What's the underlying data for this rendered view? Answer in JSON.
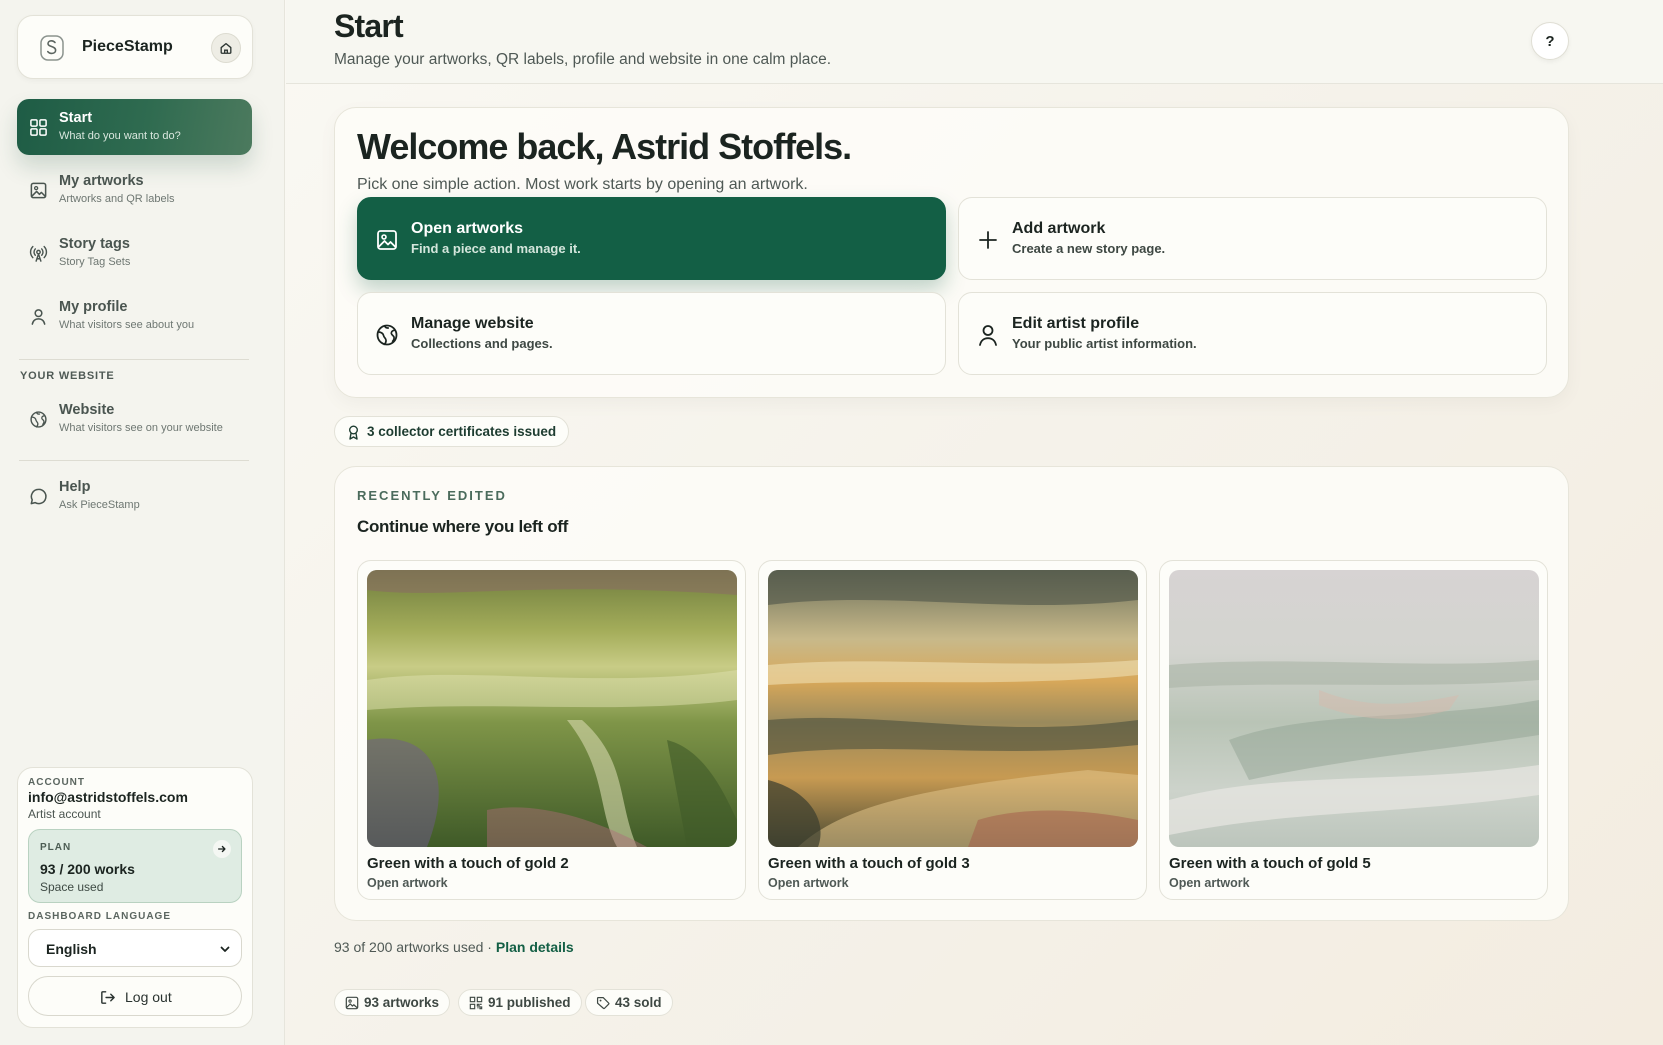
{
  "app": {
    "name": "PieceStamp"
  },
  "header": {
    "title": "Start",
    "subtitle": "Manage your artworks, QR labels, profile and website in one calm place.",
    "help_label": "?"
  },
  "sidebar": {
    "items": [
      {
        "title": "Start",
        "subtitle": "What do you want to do?",
        "icon": "grid-icon",
        "active": true
      },
      {
        "title": "My artworks",
        "subtitle": "Artworks and QR labels",
        "icon": "image-icon"
      },
      {
        "title": "Story tags",
        "subtitle": "Story Tag Sets",
        "icon": "broadcast-icon"
      },
      {
        "title": "My profile",
        "subtitle": "What visitors see about you",
        "icon": "user-icon"
      }
    ],
    "section_label": "YOUR WEBSITE",
    "website": {
      "title": "Website",
      "subtitle": "What visitors see on your website",
      "icon": "globe-icon"
    },
    "help": {
      "title": "Help",
      "subtitle": "Ask PieceStamp",
      "icon": "chat-icon"
    }
  },
  "account": {
    "label": "ACCOUNT",
    "email": "info@astridstoffels.com",
    "type": "Artist account",
    "plan": {
      "label": "PLAN",
      "value": "93 / 200 works",
      "sub": "Space used"
    },
    "language_label": "DASHBOARD LANGUAGE",
    "language": "English",
    "logout_label": "Log out"
  },
  "welcome": {
    "title": "Welcome back, Astrid Stoffels.",
    "subtitle": "Pick one simple action. Most work starts by opening an artwork.",
    "actions": [
      {
        "title": "Open artworks",
        "subtitle": "Find a piece and manage it.",
        "icon": "image-icon"
      },
      {
        "title": "Add artwork",
        "subtitle": "Create a new story page.",
        "icon": "plus-icon"
      },
      {
        "title": "Manage website",
        "subtitle": "Collections and pages.",
        "icon": "globe-icon"
      },
      {
        "title": "Edit artist profile",
        "subtitle": "Your public artist information.",
        "icon": "user-icon"
      }
    ]
  },
  "certificates": {
    "text": "3 collector certificates issued",
    "icon": "award-icon"
  },
  "recent": {
    "label": "RECENTLY EDITED",
    "title": "Continue where you left off",
    "items": [
      {
        "title": "Green with a touch of gold 2",
        "subtitle": "Open artwork"
      },
      {
        "title": "Green with a touch of gold 3",
        "subtitle": "Open artwork"
      },
      {
        "title": "Green with a touch of gold 5",
        "subtitle": "Open artwork"
      }
    ]
  },
  "usage": {
    "text": "93 of 200 artworks used · ",
    "link": "Plan details"
  },
  "stats": [
    {
      "text": "93 artworks",
      "icon": "image-icon"
    },
    {
      "text": "91 published",
      "icon": "qr-icon"
    },
    {
      "text": "43 sold",
      "icon": "tag-icon"
    }
  ],
  "colors": {
    "accent": "#135f45",
    "sidebar_active": "#2a6a4e",
    "plan_bg": "#dfece3"
  }
}
